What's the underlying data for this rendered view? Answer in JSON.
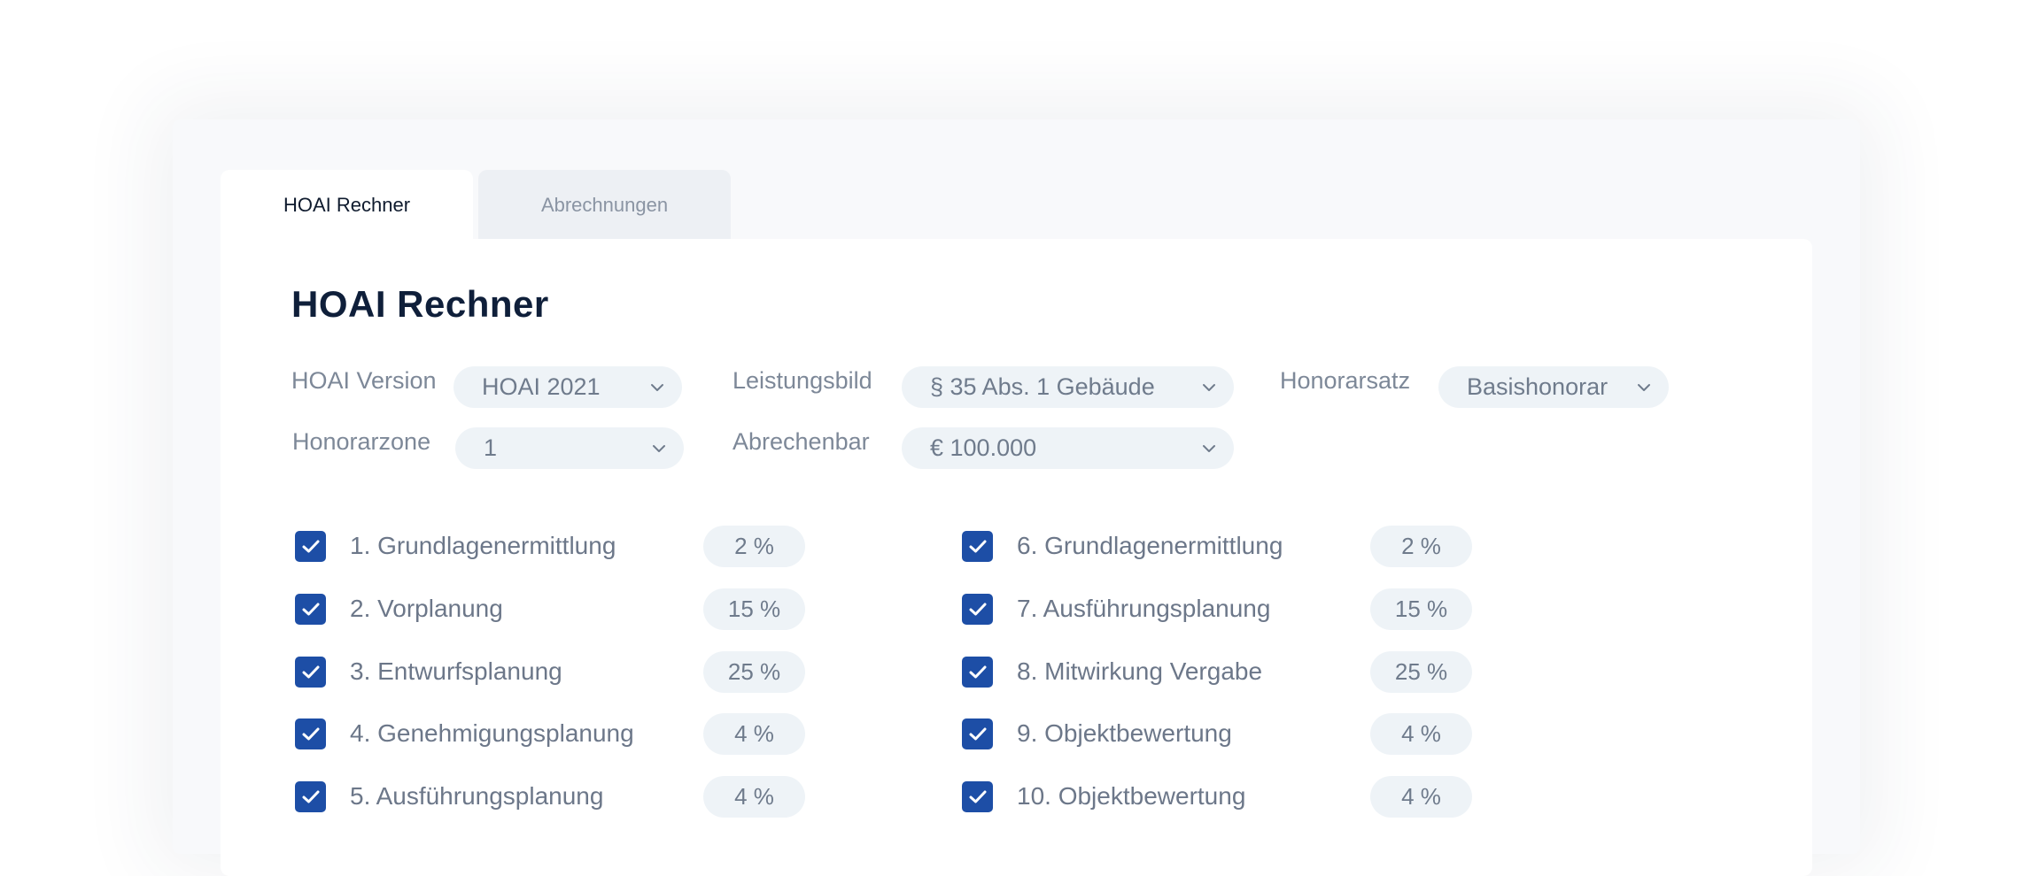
{
  "tabs": {
    "active": "HOAI Rechner",
    "inactive": "Abrechnungen"
  },
  "panel": {
    "title": "HOAI Rechner"
  },
  "fields": {
    "version": {
      "label": "HOAI Version",
      "value": "HOAI 2021"
    },
    "leistungsbild": {
      "label": "Leistungsbild",
      "value": "§ 35 Abs. 1 Gebäude"
    },
    "honorarsatz": {
      "label": "Honorarsatz",
      "value": "Basishonorar"
    },
    "honorarzone": {
      "label": "Honorarzone",
      "value": "1"
    },
    "abrechenbar": {
      "label": "Abrechenbar",
      "value": "€ 100.000"
    }
  },
  "phases_left": [
    {
      "label": "1. Grundlagenermittlung",
      "percent": "2 %",
      "checked": true
    },
    {
      "label": "2. Vorplanung",
      "percent": "15 %",
      "checked": true
    },
    {
      "label": "3. Entwurfsplanung",
      "percent": "25 %",
      "checked": true
    },
    {
      "label": "4. Genehmigungsplanung",
      "percent": "4 %",
      "checked": true
    },
    {
      "label": "5. Ausführungsplanung",
      "percent": "4 %",
      "checked": true
    }
  ],
  "phases_right": [
    {
      "label": "6. Grundlagenermittlung",
      "percent": "2 %",
      "checked": true
    },
    {
      "label": "7. Ausführungsplanung",
      "percent": "15 %",
      "checked": true
    },
    {
      "label": "8. Mitwirkung Vergabe",
      "percent": "25 %",
      "checked": true
    },
    {
      "label": "9. Objektbewertung",
      "percent": "4 %",
      "checked": true
    },
    {
      "label": "10. Objektbewertung",
      "percent": "4 %",
      "checked": true
    }
  ],
  "colors": {
    "accent": "#1d4ea6",
    "title": "#0f1f3a",
    "field_bg": "#eef3f7"
  },
  "icons": {
    "dropdown": "chevron-down-icon",
    "checkbox": "checkmark-icon"
  }
}
